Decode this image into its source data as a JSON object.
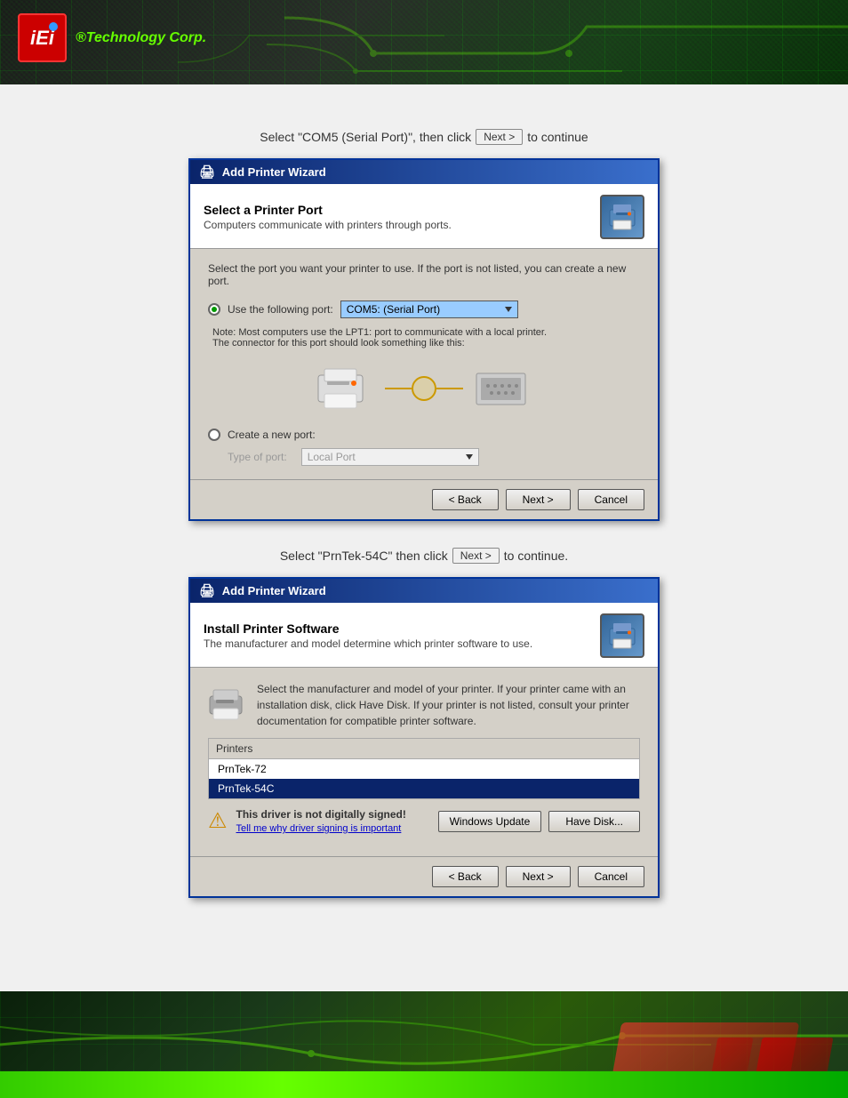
{
  "header": {
    "logo_text": "iEi",
    "logo_subtitle": "®Technology Corp."
  },
  "page": {
    "instruction1": {
      "prefix": "Select \"COM5 (Serial Port)\", then click",
      "button": "Next >",
      "suffix": "to continue"
    },
    "instruction2": {
      "prefix": "Select \"PrnTek-54C\" then click",
      "button": "Next >",
      "suffix": "to continue."
    }
  },
  "wizard1": {
    "title": "Add Printer Wizard",
    "section_title": "Select a Printer Port",
    "section_subtitle": "Computers communicate with printers through ports.",
    "port_description": "Select the port you want your printer to use.  If the port is not listed, you can create a new port.",
    "radio_use_port": "Use the following port:",
    "port_selected": "COM5: (Serial Port)",
    "port_note_line1": "Note: Most computers use the LPT1: port to communicate with a local printer.",
    "port_note_line2": "The connector for this port should look something like this:",
    "radio_create_port": "Create a new port:",
    "create_port_label": "Type of port:",
    "create_port_value": "Local Port",
    "btn_back": "< Back",
    "btn_next": "Next >",
    "btn_cancel": "Cancel"
  },
  "wizard2": {
    "title": "Add Printer Wizard",
    "section_title": "Install Printer Software",
    "section_subtitle": "The manufacturer and model determine which printer software to use.",
    "info_text": "Select the manufacturer and model of your printer. If your printer came with an installation disk, click Have Disk. If your printer is not listed, consult your printer documentation for compatible printer software.",
    "printers_label": "Printers",
    "printer_item1": "PrnTek-72",
    "printer_item2": "PrnTek-54C",
    "warning_text": "This driver is not digitally signed!",
    "warning_link": "Tell me why driver signing is important",
    "btn_windows_update": "Windows Update",
    "btn_have_disk": "Have Disk...",
    "btn_back": "< Back",
    "btn_next": "Next >",
    "btn_cancel": "Cancel"
  }
}
